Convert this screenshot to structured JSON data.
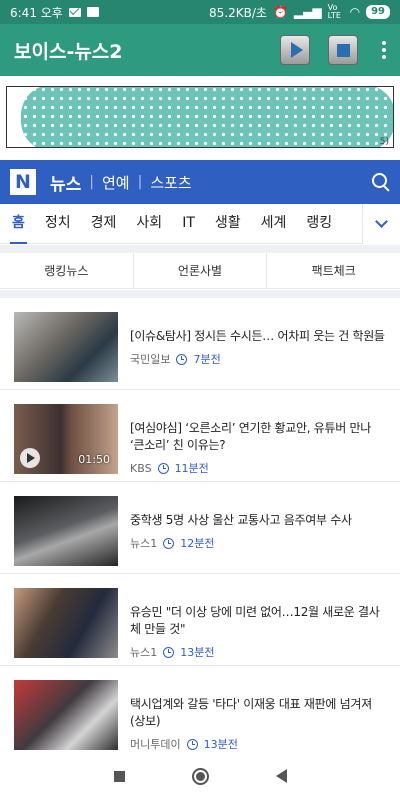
{
  "status_bar": {
    "time": "6:41 오후",
    "network_speed": "85.2KB/초",
    "network_type": "Vo LTE",
    "battery": "99"
  },
  "app_bar": {
    "title": "보이스-뉴스2",
    "play_icon": "play-icon",
    "stop_icon": "stop-icon",
    "more_icon": "more-vert-icon"
  },
  "ad": {
    "corner_text": "5)"
  },
  "naver": {
    "logo": "N",
    "sections": [
      "뉴스",
      "연예",
      "스포츠"
    ]
  },
  "categories": [
    "홈",
    "정치",
    "경제",
    "사회",
    "IT",
    "생활",
    "세계",
    "랭킹"
  ],
  "sub_tabs": [
    "랭킹뉴스",
    "언론사별",
    "팩트체크"
  ],
  "news": [
    {
      "title": "[이슈&탐사] 정시든 수시든… 어차피 웃는 건 학원들",
      "source": "국민일보",
      "time": "7분전"
    },
    {
      "title": "[여심야심] ‘오른소리’ 연기한 황교안, 유튜버 만나 ‘큰소리’ 친 이유는?",
      "source": "KBS",
      "time": "11분전",
      "duration": "01:50"
    },
    {
      "title": "중학생 5명 사상 울산 교통사고 음주여부 수사",
      "source": "뉴스1",
      "time": "12분전"
    },
    {
      "title": "유승민 \"더 이상 당에 미련 없어…12월 새로운 결사체 만들 것\"",
      "source": "뉴스1",
      "time": "13분전"
    },
    {
      "title": "택시업계와 갈등 '타다' 이재웅 대표 재판에 넘겨져(상보)",
      "source": "머니투데이",
      "time": "13분전"
    }
  ],
  "colors": {
    "status_bar": "#26866f",
    "app_bar": "#2e9a80",
    "naver_blue": "#2f5fc0"
  }
}
